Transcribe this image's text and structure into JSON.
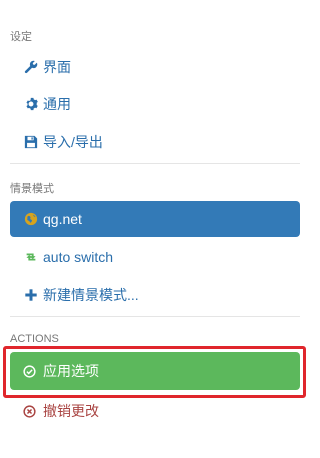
{
  "sections": {
    "settings": {
      "header": "设定",
      "items": [
        {
          "label": "界面",
          "icon": "wrench-icon"
        },
        {
          "label": "通用",
          "icon": "gear-icon"
        },
        {
          "label": "导入/导出",
          "icon": "floppy-disk-icon"
        }
      ]
    },
    "profiles": {
      "header": "情景模式",
      "items": [
        {
          "label": "qg.net",
          "icon": "globe-icon",
          "active": true
        },
        {
          "label": "auto switch",
          "icon": "retweet-icon"
        },
        {
          "label": "新建情景模式...",
          "icon": "plus-icon"
        }
      ]
    },
    "actions": {
      "header": "ACTIONS",
      "apply_label": "应用选项",
      "revert_label": "撤销更改"
    }
  },
  "colors": {
    "link": "#2a6eab",
    "active_bg": "#337ab7",
    "apply_bg": "#5cb85c",
    "revert": "#a94442",
    "highlight_border": "#e0262c",
    "globe": "#d6a31e",
    "retweet": "#5cb85c"
  }
}
